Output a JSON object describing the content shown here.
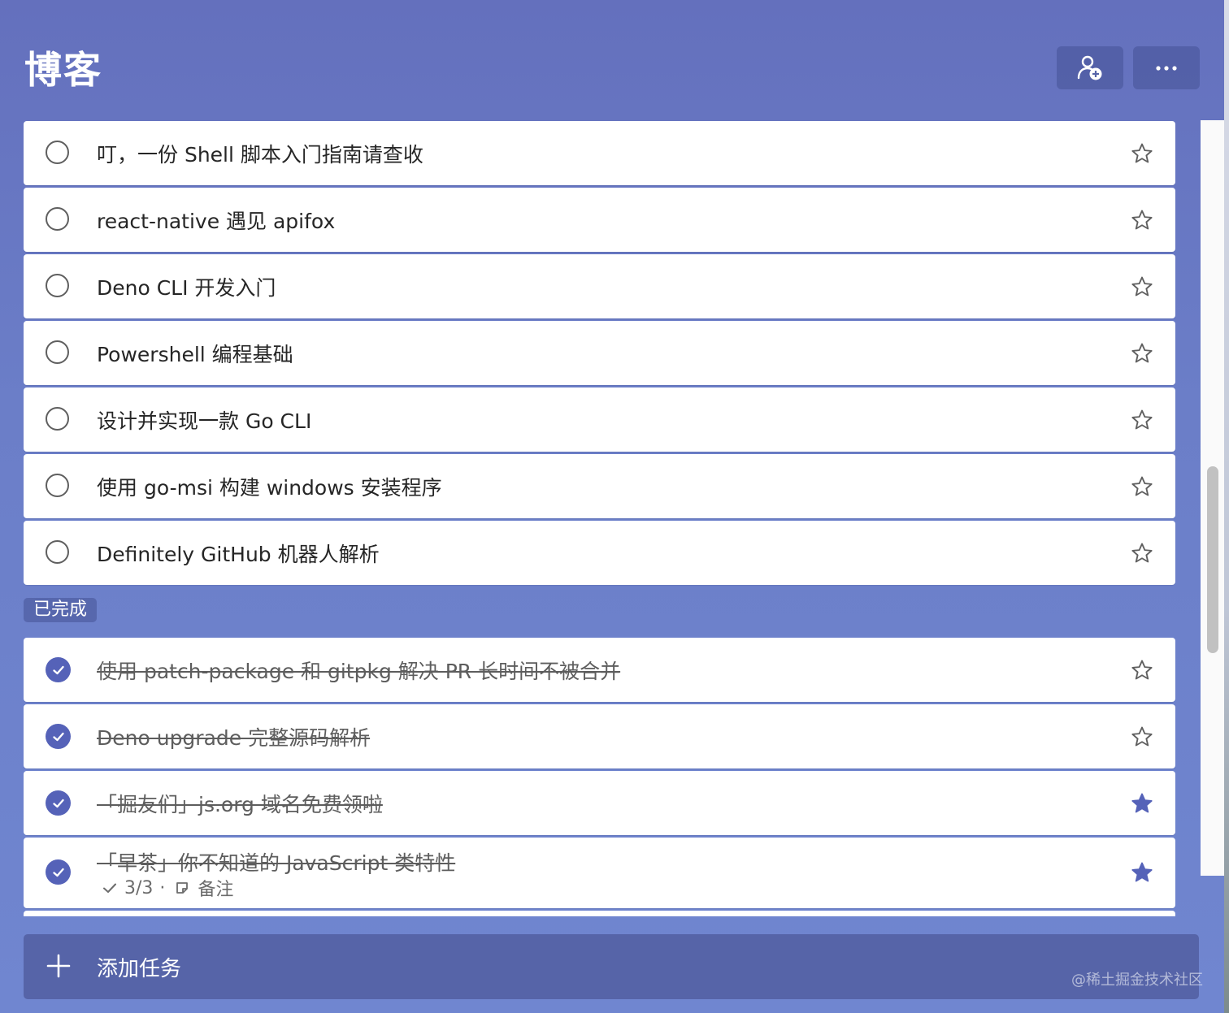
{
  "header": {
    "title": "博客"
  },
  "tasks_open": [
    {
      "text": "叮，一份 Shell 脚本入门指南请查收",
      "starred": false
    },
    {
      "text": "react-native 遇见 apifox",
      "starred": false
    },
    {
      "text": "Deno CLI 开发入门",
      "starred": false
    },
    {
      "text": "Powershell 编程基础",
      "starred": false
    },
    {
      "text": "设计并实现一款 Go CLI",
      "starred": false
    },
    {
      "text": "使用 go-msi 构建 windows 安装程序",
      "starred": false
    },
    {
      "text": "Definitely GitHub 机器人解析",
      "starred": false
    }
  ],
  "completed_section": {
    "label": "已完成"
  },
  "tasks_done": [
    {
      "text": "使用 patch-package 和 gitpkg 解决 PR 长时间不被合并",
      "starred": false
    },
    {
      "text": "Deno upgrade 完整源码解析",
      "starred": false
    },
    {
      "text": "「掘友们」js.org 域名免费领啦",
      "starred": true
    },
    {
      "text": "「早茶」你不知道的 JavaScript 类特性",
      "starred": true,
      "steps": "3/3",
      "dot": "·",
      "note": "备注"
    }
  ],
  "add_task": {
    "label": "添加任务"
  },
  "watermark": "@稀土掘金技术社区",
  "colors": {
    "accent": "#5562b8",
    "star_filled": "#5562b8",
    "background": "#6b7ec8"
  }
}
